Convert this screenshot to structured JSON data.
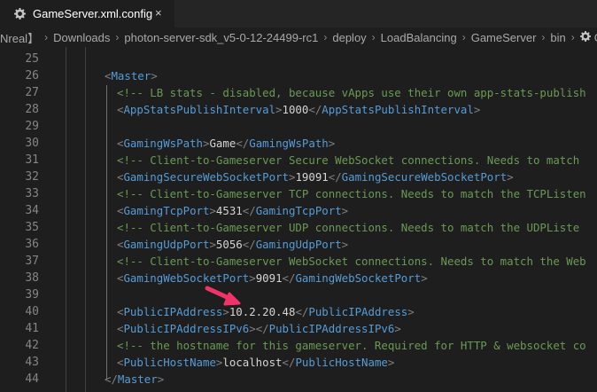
{
  "tab": {
    "title": "GameServer.xml.config",
    "close_glyph": "×",
    "icon": "gear-icon"
  },
  "breadcrumb": [
    "Nreal】",
    "Downloads",
    "photon-server-sdk_v5-0-12-24499-rc1",
    "deploy",
    "LoadBalancing",
    "GameServer",
    "bin",
    "Ga"
  ],
  "editor": {
    "lines": [
      {
        "num": "25",
        "tokens": []
      },
      {
        "num": "26",
        "tokens": [
          {
            "t": "b",
            "v": "<"
          },
          {
            "t": "g",
            "v": "Master"
          },
          {
            "t": "b",
            "v": ">"
          }
        ]
      },
      {
        "num": "27",
        "tokens": [
          {
            "t": "c",
            "v": "<!-- LB stats - disabled, because vApps use their own app-stats-publish"
          }
        ]
      },
      {
        "num": "28",
        "tokens": [
          {
            "t": "b",
            "v": "<"
          },
          {
            "t": "g",
            "v": "AppStatsPublishInterval"
          },
          {
            "t": "b",
            "v": ">"
          },
          {
            "t": "x",
            "v": "1000"
          },
          {
            "t": "b",
            "v": "</"
          },
          {
            "t": "g",
            "v": "AppStatsPublishInterval"
          },
          {
            "t": "b",
            "v": ">"
          }
        ]
      },
      {
        "num": "29",
        "tokens": []
      },
      {
        "num": "30",
        "tokens": [
          {
            "t": "b",
            "v": "<"
          },
          {
            "t": "g",
            "v": "GamingWsPath"
          },
          {
            "t": "b",
            "v": ">"
          },
          {
            "t": "x",
            "v": "Game"
          },
          {
            "t": "b",
            "v": "</"
          },
          {
            "t": "g",
            "v": "GamingWsPath"
          },
          {
            "t": "b",
            "v": ">"
          }
        ]
      },
      {
        "num": "31",
        "tokens": [
          {
            "t": "c",
            "v": "<!-- Client-to-Gameserver Secure WebSocket connections. Needs to match"
          }
        ]
      },
      {
        "num": "32",
        "tokens": [
          {
            "t": "b",
            "v": "<"
          },
          {
            "t": "g",
            "v": "GamingSecureWebSocketPort"
          },
          {
            "t": "b",
            "v": ">"
          },
          {
            "t": "x",
            "v": "19091"
          },
          {
            "t": "b",
            "v": "</"
          },
          {
            "t": "g",
            "v": "GamingSecureWebSocketPort"
          },
          {
            "t": "b",
            "v": ">"
          }
        ]
      },
      {
        "num": "33",
        "tokens": [
          {
            "t": "c",
            "v": "<!-- Client-to-Gameserver TCP connections. Needs to match the TCPListen"
          }
        ]
      },
      {
        "num": "34",
        "tokens": [
          {
            "t": "b",
            "v": "<"
          },
          {
            "t": "g",
            "v": "GamingTcpPort"
          },
          {
            "t": "b",
            "v": ">"
          },
          {
            "t": "x",
            "v": "4531"
          },
          {
            "t": "b",
            "v": "</"
          },
          {
            "t": "g",
            "v": "GamingTcpPort"
          },
          {
            "t": "b",
            "v": ">"
          }
        ]
      },
      {
        "num": "35",
        "tokens": [
          {
            "t": "c",
            "v": "<!-- Client-to-Gameserver UDP connections. Needs to match the UDPListe"
          }
        ]
      },
      {
        "num": "36",
        "tokens": [
          {
            "t": "b",
            "v": "<"
          },
          {
            "t": "g",
            "v": "GamingUdpPort"
          },
          {
            "t": "b",
            "v": ">"
          },
          {
            "t": "x",
            "v": "5056"
          },
          {
            "t": "b",
            "v": "</"
          },
          {
            "t": "g",
            "v": "GamingUdpPort"
          },
          {
            "t": "b",
            "v": ">"
          }
        ]
      },
      {
        "num": "37",
        "tokens": [
          {
            "t": "c",
            "v": "<!-- Client-to-Gameserver WebSocket connections. Needs to match the Web"
          }
        ]
      },
      {
        "num": "38",
        "tokens": [
          {
            "t": "b",
            "v": "<"
          },
          {
            "t": "g",
            "v": "GamingWebSocketPort"
          },
          {
            "t": "b",
            "v": ">"
          },
          {
            "t": "x",
            "v": "9091"
          },
          {
            "t": "b",
            "v": "</"
          },
          {
            "t": "g",
            "v": "GamingWebSocketPort"
          },
          {
            "t": "b",
            "v": ">"
          }
        ]
      },
      {
        "num": "39",
        "tokens": []
      },
      {
        "num": "40",
        "tokens": [
          {
            "t": "b",
            "v": "<"
          },
          {
            "t": "g",
            "v": "PublicIPAddress"
          },
          {
            "t": "b",
            "v": ">"
          },
          {
            "t": "x",
            "v": "10.2.20.48"
          },
          {
            "t": "b",
            "v": "</"
          },
          {
            "t": "g",
            "v": "PublicIPAddress"
          },
          {
            "t": "b",
            "v": ">"
          }
        ]
      },
      {
        "num": "41",
        "tokens": [
          {
            "t": "b",
            "v": "<"
          },
          {
            "t": "g",
            "v": "PublicIPAddressIPv6"
          },
          {
            "t": "b",
            "v": ">"
          },
          {
            "t": "b",
            "v": "</"
          },
          {
            "t": "g",
            "v": "PublicIPAddressIPv6"
          },
          {
            "t": "b",
            "v": ">"
          }
        ]
      },
      {
        "num": "42",
        "tokens": [
          {
            "t": "c",
            "v": "<!-- the hostname for this gameserver. Required for HTTP & websocket co"
          }
        ]
      },
      {
        "num": "43",
        "tokens": [
          {
            "t": "b",
            "v": "<"
          },
          {
            "t": "g",
            "v": "PublicHostName"
          },
          {
            "t": "b",
            "v": ">"
          },
          {
            "t": "x",
            "v": "localhost"
          },
          {
            "t": "b",
            "v": "</"
          },
          {
            "t": "g",
            "v": "PublicHostName"
          },
          {
            "t": "b",
            "v": ">"
          }
        ]
      },
      {
        "num": "44",
        "tokens": [
          {
            "t": "b",
            "v": "</"
          },
          {
            "t": "g",
            "v": "Master"
          },
          {
            "t": "b",
            "v": ">"
          }
        ]
      }
    ]
  },
  "annotation": {
    "arrow_color": "#f0346a",
    "points_to_line": "40"
  },
  "colors": {
    "tag": "#569cd6",
    "bracket": "#808080",
    "text": "#d4d4d4",
    "comment": "#6a9955",
    "line_number": "#858585",
    "background": "#1e1e1e"
  }
}
